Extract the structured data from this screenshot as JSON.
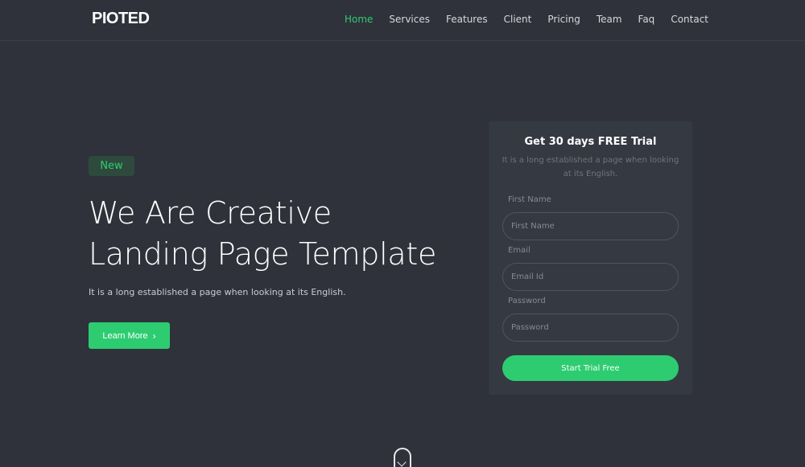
{
  "brand": {
    "logo_text": "PIOTED"
  },
  "nav": {
    "items": [
      {
        "label": "Home",
        "active": true
      },
      {
        "label": "Services",
        "active": false
      },
      {
        "label": "Features",
        "active": false
      },
      {
        "label": "Client",
        "active": false
      },
      {
        "label": "Pricing",
        "active": false
      },
      {
        "label": "Team",
        "active": false
      },
      {
        "label": "Faq",
        "active": false
      },
      {
        "label": "Contact",
        "active": false
      }
    ]
  },
  "hero": {
    "badge": "New",
    "title_line1": "We Are Creative",
    "title_line2": "Landing Page Template",
    "subtitle": "It is a long established a page when looking at its English.",
    "cta_label": "Learn More",
    "cta_icon": "chevron-right-icon"
  },
  "trial_form": {
    "title": "Get 30 days FREE Trial",
    "description": "It is a long established a page when looking at its English.",
    "first_name": {
      "label": "First Name",
      "placeholder": "First Name",
      "value": ""
    },
    "email": {
      "label": "Email",
      "placeholder": "Email Id",
      "value": ""
    },
    "password": {
      "label": "Password",
      "placeholder": "Password",
      "value": ""
    },
    "submit_label": "Start Trial Free"
  },
  "scroll_indicator": {
    "icon": "chevron-down-icon"
  },
  "colors": {
    "background": "#2f323b",
    "card": "#353942",
    "accent": "#2ecc71",
    "badge_bg": "#2e4a3c"
  }
}
